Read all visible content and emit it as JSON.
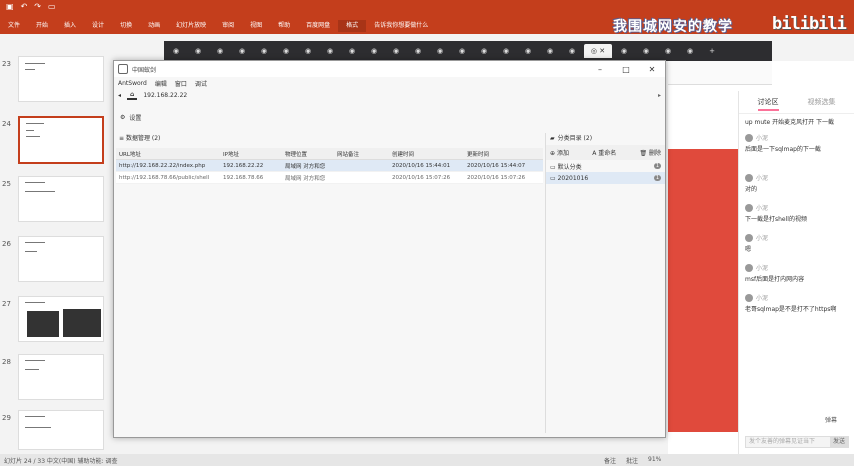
{
  "ribbon": {
    "tabs": [
      "文件",
      "开始",
      "插入",
      "设计",
      "切换",
      "动画",
      "幻灯片放映",
      "审阅",
      "视图",
      "帮助",
      "百度网盘",
      "格式",
      "告诉我你想要做什么"
    ],
    "live_title": "我围城网安的教学",
    "watermark": "bilibili"
  },
  "thumbnails": [
    {
      "num": "23"
    },
    {
      "num": "24"
    },
    {
      "num": "25"
    },
    {
      "num": "26"
    },
    {
      "num": "27"
    },
    {
      "num": "28"
    },
    {
      "num": "29"
    }
  ],
  "antsword": {
    "window_title": "中国蚁剑",
    "menu": [
      "AntSword",
      "编辑",
      "窗口",
      "调试"
    ],
    "tab_home": "⌂",
    "tab_host": "192.168.22.22",
    "settings": "设置",
    "list_title": "数据管理 (2)",
    "columns": [
      "URL地址",
      "IP地址",
      "物理位置",
      "网站备注",
      "创建时间",
      "更新时间"
    ],
    "rows": [
      [
        "http://192.168.22.22/index.php",
        "192.168.22.22",
        "局域网 对方和您",
        "",
        "2020/10/16 15:44:01",
        "2020/10/16 15:44:07"
      ],
      [
        "http://192.168.78.66/public/shell",
        "192.168.78.66",
        "局域网 对方和您",
        "",
        "2020/10/16 15:07:26",
        "2020/10/16 15:07:26"
      ]
    ],
    "category_title": "分类目录 (2)",
    "category_tools": [
      "添加",
      "重命名",
      "删除"
    ],
    "categories": [
      {
        "name": "默认分类",
        "count": "1"
      },
      {
        "name": "20201016",
        "count": "1"
      }
    ]
  },
  "chat": {
    "tabs": [
      "讨论区",
      "视频选集"
    ],
    "messages": [
      {
        "user": "",
        "text": "up mute 开始麦克风打开 下一截"
      },
      {
        "user": "小泥",
        "text": "后面是一下sqlmap的下一截"
      },
      {
        "user": "小泥",
        "text": "对的"
      },
      {
        "user": "小泥",
        "text": "下一截是打shell的视频"
      },
      {
        "user": "小泥",
        "text": "嗯"
      },
      {
        "user": "小泥",
        "text": "msf后面是打内网内容"
      },
      {
        "user": "小泥",
        "text": "老哥sqlmap是不是打不了https啊"
      }
    ],
    "send_placeholder": "发个友善的弹幕见证当下",
    "send": "发送",
    "footer": "弹幕"
  },
  "status": {
    "left": "幻灯片 24 / 33  中文(中国)  辅助功能: 调查",
    "right": [
      "备注",
      "批注",
      "91%"
    ]
  }
}
